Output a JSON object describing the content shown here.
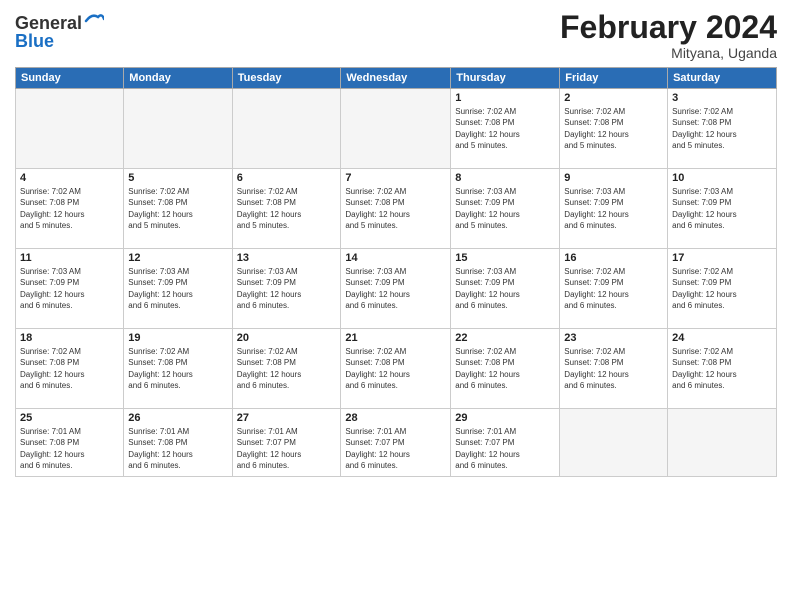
{
  "header": {
    "logo_general": "General",
    "logo_blue": "Blue",
    "title": "February 2024",
    "subtitle": "Mityana, Uganda"
  },
  "weekdays": [
    "Sunday",
    "Monday",
    "Tuesday",
    "Wednesday",
    "Thursday",
    "Friday",
    "Saturday"
  ],
  "weeks": [
    [
      {
        "day": "",
        "info": ""
      },
      {
        "day": "",
        "info": ""
      },
      {
        "day": "",
        "info": ""
      },
      {
        "day": "",
        "info": ""
      },
      {
        "day": "1",
        "info": "Sunrise: 7:02 AM\nSunset: 7:08 PM\nDaylight: 12 hours\nand 5 minutes."
      },
      {
        "day": "2",
        "info": "Sunrise: 7:02 AM\nSunset: 7:08 PM\nDaylight: 12 hours\nand 5 minutes."
      },
      {
        "day": "3",
        "info": "Sunrise: 7:02 AM\nSunset: 7:08 PM\nDaylight: 12 hours\nand 5 minutes."
      }
    ],
    [
      {
        "day": "4",
        "info": "Sunrise: 7:02 AM\nSunset: 7:08 PM\nDaylight: 12 hours\nand 5 minutes."
      },
      {
        "day": "5",
        "info": "Sunrise: 7:02 AM\nSunset: 7:08 PM\nDaylight: 12 hours\nand 5 minutes."
      },
      {
        "day": "6",
        "info": "Sunrise: 7:02 AM\nSunset: 7:08 PM\nDaylight: 12 hours\nand 5 minutes."
      },
      {
        "day": "7",
        "info": "Sunrise: 7:02 AM\nSunset: 7:08 PM\nDaylight: 12 hours\nand 5 minutes."
      },
      {
        "day": "8",
        "info": "Sunrise: 7:03 AM\nSunset: 7:09 PM\nDaylight: 12 hours\nand 5 minutes."
      },
      {
        "day": "9",
        "info": "Sunrise: 7:03 AM\nSunset: 7:09 PM\nDaylight: 12 hours\nand 6 minutes."
      },
      {
        "day": "10",
        "info": "Sunrise: 7:03 AM\nSunset: 7:09 PM\nDaylight: 12 hours\nand 6 minutes."
      }
    ],
    [
      {
        "day": "11",
        "info": "Sunrise: 7:03 AM\nSunset: 7:09 PM\nDaylight: 12 hours\nand 6 minutes."
      },
      {
        "day": "12",
        "info": "Sunrise: 7:03 AM\nSunset: 7:09 PM\nDaylight: 12 hours\nand 6 minutes."
      },
      {
        "day": "13",
        "info": "Sunrise: 7:03 AM\nSunset: 7:09 PM\nDaylight: 12 hours\nand 6 minutes."
      },
      {
        "day": "14",
        "info": "Sunrise: 7:03 AM\nSunset: 7:09 PM\nDaylight: 12 hours\nand 6 minutes."
      },
      {
        "day": "15",
        "info": "Sunrise: 7:03 AM\nSunset: 7:09 PM\nDaylight: 12 hours\nand 6 minutes."
      },
      {
        "day": "16",
        "info": "Sunrise: 7:02 AM\nSunset: 7:09 PM\nDaylight: 12 hours\nand 6 minutes."
      },
      {
        "day": "17",
        "info": "Sunrise: 7:02 AM\nSunset: 7:09 PM\nDaylight: 12 hours\nand 6 minutes."
      }
    ],
    [
      {
        "day": "18",
        "info": "Sunrise: 7:02 AM\nSunset: 7:08 PM\nDaylight: 12 hours\nand 6 minutes."
      },
      {
        "day": "19",
        "info": "Sunrise: 7:02 AM\nSunset: 7:08 PM\nDaylight: 12 hours\nand 6 minutes."
      },
      {
        "day": "20",
        "info": "Sunrise: 7:02 AM\nSunset: 7:08 PM\nDaylight: 12 hours\nand 6 minutes."
      },
      {
        "day": "21",
        "info": "Sunrise: 7:02 AM\nSunset: 7:08 PM\nDaylight: 12 hours\nand 6 minutes."
      },
      {
        "day": "22",
        "info": "Sunrise: 7:02 AM\nSunset: 7:08 PM\nDaylight: 12 hours\nand 6 minutes."
      },
      {
        "day": "23",
        "info": "Sunrise: 7:02 AM\nSunset: 7:08 PM\nDaylight: 12 hours\nand 6 minutes."
      },
      {
        "day": "24",
        "info": "Sunrise: 7:02 AM\nSunset: 7:08 PM\nDaylight: 12 hours\nand 6 minutes."
      }
    ],
    [
      {
        "day": "25",
        "info": "Sunrise: 7:01 AM\nSunset: 7:08 PM\nDaylight: 12 hours\nand 6 minutes."
      },
      {
        "day": "26",
        "info": "Sunrise: 7:01 AM\nSunset: 7:08 PM\nDaylight: 12 hours\nand 6 minutes."
      },
      {
        "day": "27",
        "info": "Sunrise: 7:01 AM\nSunset: 7:07 PM\nDaylight: 12 hours\nand 6 minutes."
      },
      {
        "day": "28",
        "info": "Sunrise: 7:01 AM\nSunset: 7:07 PM\nDaylight: 12 hours\nand 6 minutes."
      },
      {
        "day": "29",
        "info": "Sunrise: 7:01 AM\nSunset: 7:07 PM\nDaylight: 12 hours\nand 6 minutes."
      },
      {
        "day": "",
        "info": ""
      },
      {
        "day": "",
        "info": ""
      }
    ]
  ]
}
